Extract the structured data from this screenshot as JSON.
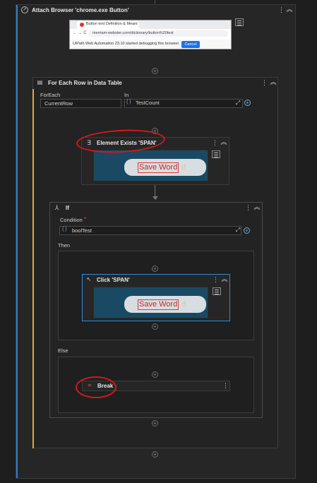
{
  "attach": {
    "title": "Attach Browser 'chrome.exe Button'",
    "browser": {
      "tab_title": "Button text Definition & Meanin...",
      "url": "merriam-webster.com/dictionary/button%20text",
      "notice": "UiPath Web Automation 23.10 started debugging this browser",
      "cancel_label": "Cancel"
    }
  },
  "foreach": {
    "title": "For Each Row in Data Table",
    "foreach_label": "ForEach",
    "foreach_value": "CurrentRow",
    "in_label": "In",
    "in_value": "TestCount"
  },
  "element_exists": {
    "title": "Element Exists 'SPAN'",
    "target_text": "Save Word"
  },
  "if_block": {
    "title": "If",
    "condition_label": "Condition",
    "required_mark": "*",
    "condition_value": "boolTest",
    "then_label": "Then",
    "else_label": "Else"
  },
  "click": {
    "title": "Click 'SPAN'",
    "target_text": "Save Word"
  },
  "break_activity": {
    "title": "Break"
  },
  "icons": {
    "more": "⋮",
    "collapse": "«",
    "plus": "+",
    "expr": "{ }",
    "expand": "⤢"
  },
  "colors": {
    "selection_blue": "#2d8bd6",
    "annotation_red": "#d31919",
    "foreach_accent": "#e6a53a",
    "attach_accent": "#2f7fd0",
    "cancel_button": "#1a73e8"
  }
}
